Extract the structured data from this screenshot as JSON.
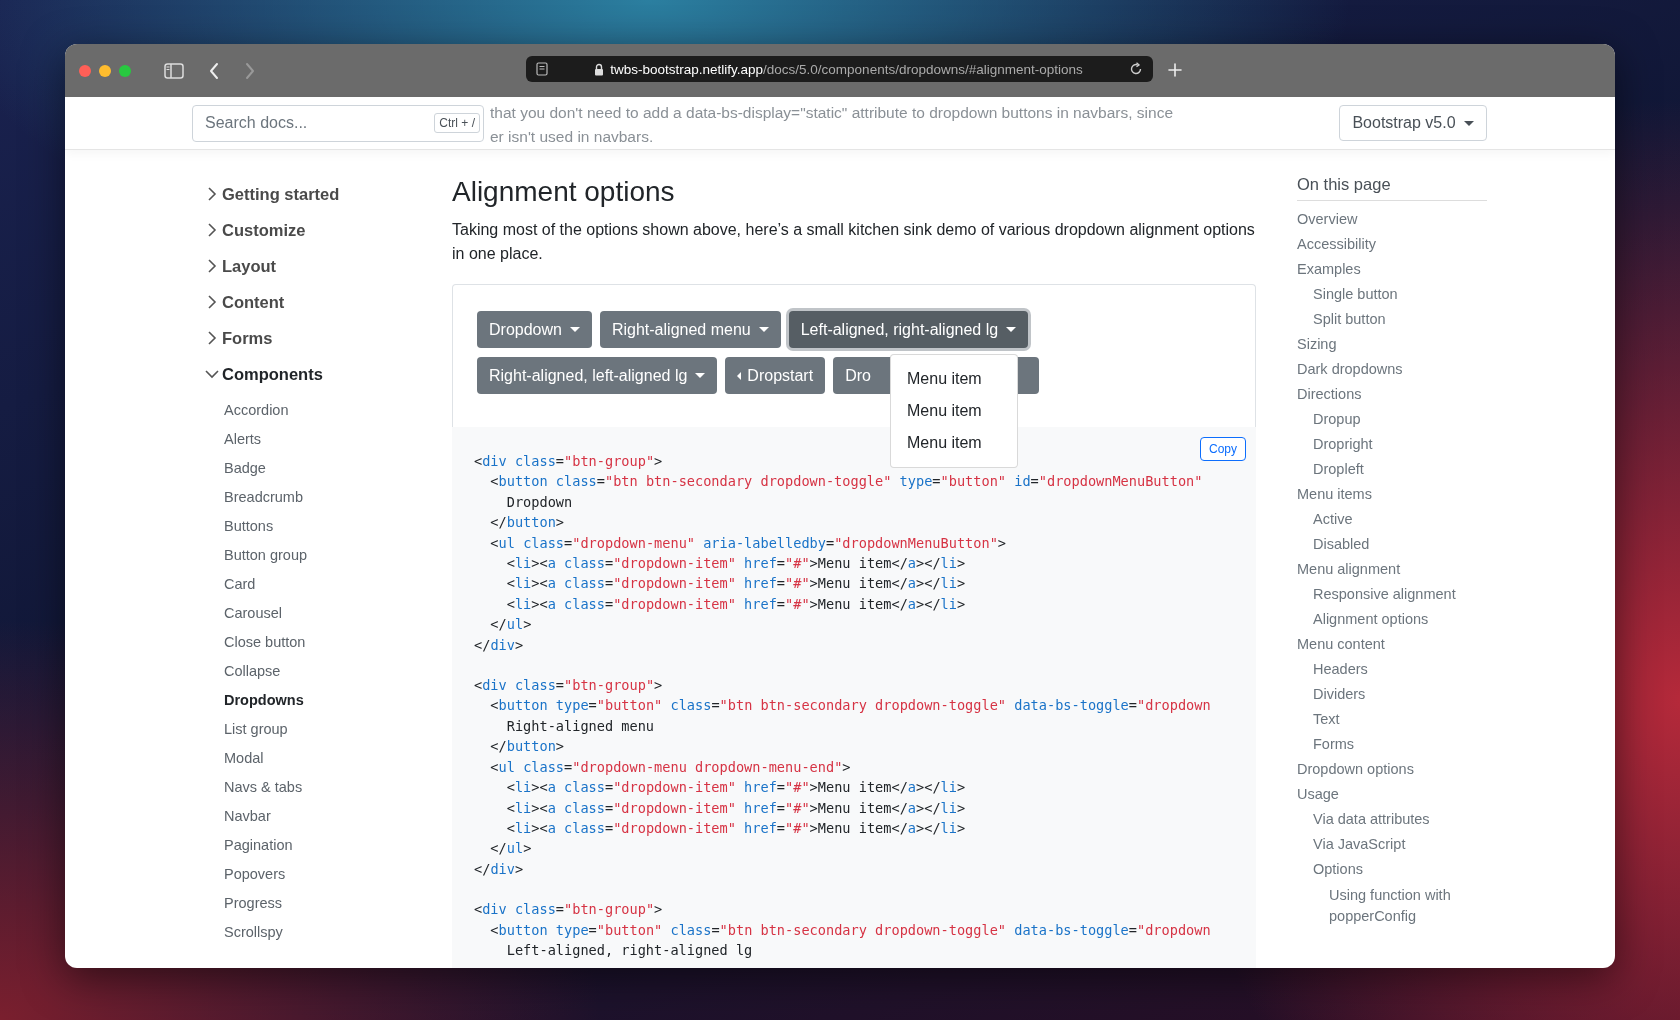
{
  "browser": {
    "url_host": "twbs-bootstrap.netlify.app",
    "url_path": "/docs/5.0/components/dropdowns/#alignment-options"
  },
  "header": {
    "search": {
      "placeholder": "Search docs...",
      "shortcut": "Ctrl + /"
    },
    "behind_text": [
      "that you don't need to add a data-bs-display=\"static\" attribute to dropdown buttons in navbars, since",
      "er isn't used in navbars."
    ],
    "version": "Bootstrap v5.0"
  },
  "sidebar": {
    "sections": [
      {
        "label": "Getting started",
        "expanded": false
      },
      {
        "label": "Customize",
        "expanded": false
      },
      {
        "label": "Layout",
        "expanded": false
      },
      {
        "label": "Content",
        "expanded": false
      },
      {
        "label": "Forms",
        "expanded": false
      },
      {
        "label": "Components",
        "expanded": true,
        "items": [
          {
            "label": "Accordion",
            "selected": false
          },
          {
            "label": "Alerts",
            "selected": false
          },
          {
            "label": "Badge",
            "selected": false
          },
          {
            "label": "Breadcrumb",
            "selected": false
          },
          {
            "label": "Buttons",
            "selected": false
          },
          {
            "label": "Button group",
            "selected": false
          },
          {
            "label": "Card",
            "selected": false
          },
          {
            "label": "Carousel",
            "selected": false
          },
          {
            "label": "Close button",
            "selected": false
          },
          {
            "label": "Collapse",
            "selected": false
          },
          {
            "label": "Dropdowns",
            "selected": true
          },
          {
            "label": "List group",
            "selected": false
          },
          {
            "label": "Modal",
            "selected": false
          },
          {
            "label": "Navs & tabs",
            "selected": false
          },
          {
            "label": "Navbar",
            "selected": false
          },
          {
            "label": "Pagination",
            "selected": false
          },
          {
            "label": "Popovers",
            "selected": false
          },
          {
            "label": "Progress",
            "selected": false
          },
          {
            "label": "Scrollspy",
            "selected": false
          }
        ]
      }
    ]
  },
  "main": {
    "title": "Alignment options",
    "intro": "Taking most of the options shown above, here’s a small kitchen sink demo of various dropdown alignment options in one place.",
    "example": {
      "rows": [
        [
          {
            "label": "Dropdown",
            "kind": "dropdown",
            "expanded": false
          },
          {
            "label": "Right-aligned menu",
            "kind": "dropdown",
            "expanded": false
          },
          {
            "label": "Left-aligned, right-aligned lg",
            "kind": "dropdown",
            "expanded": true
          }
        ],
        [
          {
            "label": "Right-aligned, left-aligned lg",
            "kind": "dropdown",
            "expanded": false
          },
          {
            "label": "Dropstart",
            "kind": "dropstart",
            "expanded": false
          },
          {
            "label": "Dro",
            "kind": "cut",
            "expanded": false
          }
        ]
      ],
      "menu": [
        "Menu item",
        "Menu item",
        "Menu item"
      ]
    },
    "copy_button": "Copy",
    "code_blocks": [
      [
        "<div class=\"btn-group\">",
        "  <button class=\"btn btn-secondary dropdown-toggle\" type=\"button\" id=\"dropdownMenuButton\"",
        "    Dropdown",
        "  </button>",
        "  <ul class=\"dropdown-menu\" aria-labelledby=\"dropdownMenuButton\">",
        "    <li><a class=\"dropdown-item\" href=\"#\">Menu item</a></li>",
        "    <li><a class=\"dropdown-item\" href=\"#\">Menu item</a></li>",
        "    <li><a class=\"dropdown-item\" href=\"#\">Menu item</a></li>",
        "  </ul>",
        "</div>"
      ],
      [
        "<div class=\"btn-group\">",
        "  <button type=\"button\" class=\"btn btn-secondary dropdown-toggle\" data-bs-toggle=\"dropdown",
        "    Right-aligned menu",
        "  </button>",
        "  <ul class=\"dropdown-menu dropdown-menu-end\">",
        "    <li><a class=\"dropdown-item\" href=\"#\">Menu item</a></li>",
        "    <li><a class=\"dropdown-item\" href=\"#\">Menu item</a></li>",
        "    <li><a class=\"dropdown-item\" href=\"#\">Menu item</a></li>",
        "  </ul>",
        "</div>"
      ],
      [
        "<div class=\"btn-group\">",
        "  <button type=\"button\" class=\"btn btn-secondary dropdown-toggle\" data-bs-toggle=\"dropdown",
        "    Left-aligned, right-aligned lg"
      ]
    ]
  },
  "toc": {
    "title": "On this page",
    "items": [
      {
        "label": "Overview"
      },
      {
        "label": "Accessibility"
      },
      {
        "label": "Examples",
        "children": [
          {
            "label": "Single button"
          },
          {
            "label": "Split button"
          }
        ]
      },
      {
        "label": "Sizing"
      },
      {
        "label": "Dark dropdowns"
      },
      {
        "label": "Directions",
        "children": [
          {
            "label": "Dropup"
          },
          {
            "label": "Dropright"
          },
          {
            "label": "Dropleft"
          }
        ]
      },
      {
        "label": "Menu items",
        "children": [
          {
            "label": "Active"
          },
          {
            "label": "Disabled"
          }
        ]
      },
      {
        "label": "Menu alignment",
        "children": [
          {
            "label": "Responsive alignment"
          },
          {
            "label": "Alignment options"
          }
        ]
      },
      {
        "label": "Menu content",
        "children": [
          {
            "label": "Headers"
          },
          {
            "label": "Dividers"
          },
          {
            "label": "Text"
          },
          {
            "label": "Forms"
          }
        ]
      },
      {
        "label": "Dropdown options"
      },
      {
        "label": "Usage",
        "children": [
          {
            "label": "Via data attributes"
          },
          {
            "label": "Via JavaScript"
          },
          {
            "label": "Options",
            "children": [
              {
                "label": "Using function with popperConfig"
              }
            ]
          }
        ]
      }
    ]
  }
}
